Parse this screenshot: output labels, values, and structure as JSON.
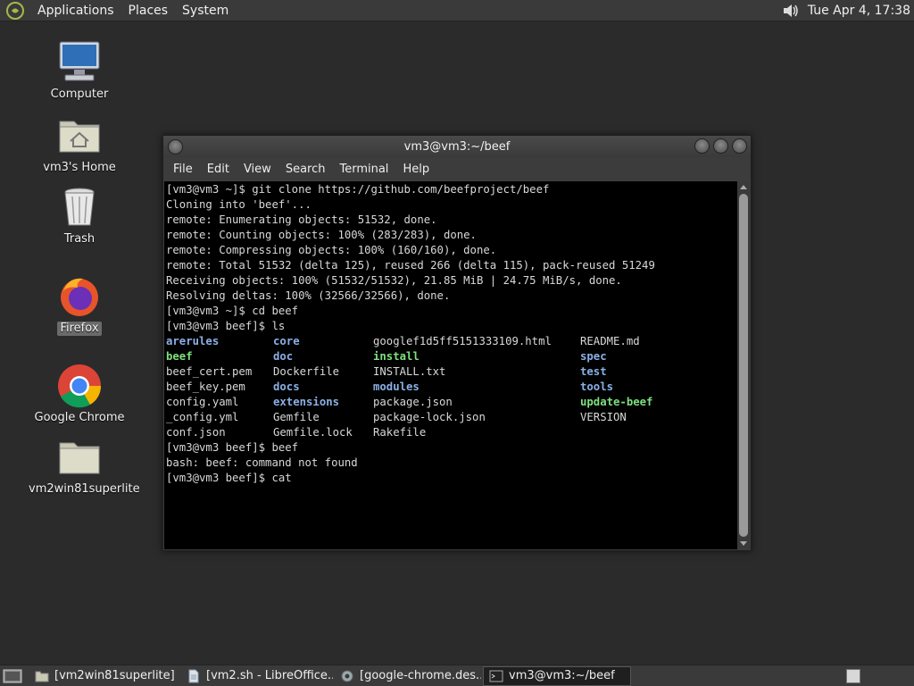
{
  "top_panel": {
    "menus": [
      "Applications",
      "Places",
      "System"
    ],
    "clock": "Tue Apr  4, 17:38"
  },
  "desktop_icons": [
    {
      "label": "Computer"
    },
    {
      "label": "vm3's Home"
    },
    {
      "label": "Trash"
    },
    {
      "label": "Firefox"
    },
    {
      "label": "Google Chrome"
    },
    {
      "label": "vm2win81superlite"
    }
  ],
  "terminal": {
    "title": "vm3@vm3:~/beef",
    "menus": [
      "File",
      "Edit",
      "View",
      "Search",
      "Terminal",
      "Help"
    ],
    "lines_before": [
      "[vm3@vm3 ~]$ git clone https://github.com/beefproject/beef",
      "Cloning into 'beef'...",
      "remote: Enumerating objects: 51532, done.",
      "remote: Counting objects: 100% (283/283), done.",
      "remote: Compressing objects: 100% (160/160), done.",
      "remote: Total 51532 (delta 125), reused 266 (delta 115), pack-reused 51249",
      "Receiving objects: 100% (51532/51532), 21.85 MiB | 24.75 MiB/s, done.",
      "Resolving deltas: 100% (32566/32566), done.",
      "[vm3@vm3 ~]$ cd beef",
      "[vm3@vm3 beef]$ ls"
    ],
    "ls_rows": [
      [
        {
          "t": "arerules",
          "k": "dir"
        },
        {
          "t": "core",
          "k": "dir"
        },
        {
          "t": "googlef1d5ff5151333109.html",
          "k": ""
        },
        {
          "t": "README.md",
          "k": ""
        }
      ],
      [
        {
          "t": "beef",
          "k": "exe"
        },
        {
          "t": "doc",
          "k": "dir"
        },
        {
          "t": "install",
          "k": "exe"
        },
        {
          "t": "spec",
          "k": "dir"
        }
      ],
      [
        {
          "t": "beef_cert.pem",
          "k": ""
        },
        {
          "t": "Dockerfile",
          "k": ""
        },
        {
          "t": "INSTALL.txt",
          "k": ""
        },
        {
          "t": "test",
          "k": "dir"
        }
      ],
      [
        {
          "t": "beef_key.pem",
          "k": ""
        },
        {
          "t": "docs",
          "k": "dir"
        },
        {
          "t": "modules",
          "k": "dir"
        },
        {
          "t": "tools",
          "k": "dir"
        }
      ],
      [
        {
          "t": "config.yaml",
          "k": ""
        },
        {
          "t": "extensions",
          "k": "dir"
        },
        {
          "t": "package.json",
          "k": ""
        },
        {
          "t": "update-beef",
          "k": "exe"
        }
      ],
      [
        {
          "t": "_config.yml",
          "k": ""
        },
        {
          "t": "Gemfile",
          "k": ""
        },
        {
          "t": "package-lock.json",
          "k": ""
        },
        {
          "t": "VERSION",
          "k": ""
        }
      ],
      [
        {
          "t": "conf.json",
          "k": ""
        },
        {
          "t": "Gemfile.lock",
          "k": ""
        },
        {
          "t": "Rakefile",
          "k": ""
        },
        {
          "t": "",
          "k": ""
        }
      ]
    ],
    "lines_after": [
      "[vm3@vm3 beef]$ beef",
      "bash: beef: command not found",
      "[vm3@vm3 beef]$ cat"
    ]
  },
  "taskbar": {
    "tasks": [
      {
        "label": "[vm2win81superlite]",
        "icon": "folder-icon",
        "active": false
      },
      {
        "label": "[vm2.sh - LibreOffice...",
        "icon": "document-icon",
        "active": false
      },
      {
        "label": "[google-chrome.des...",
        "icon": "gear-icon",
        "active": false
      },
      {
        "label": "vm3@vm3:~/beef",
        "icon": "terminal-icon",
        "active": true
      }
    ]
  },
  "colors": {
    "dir": "#8ab0e6",
    "exe": "#7ee07e"
  }
}
